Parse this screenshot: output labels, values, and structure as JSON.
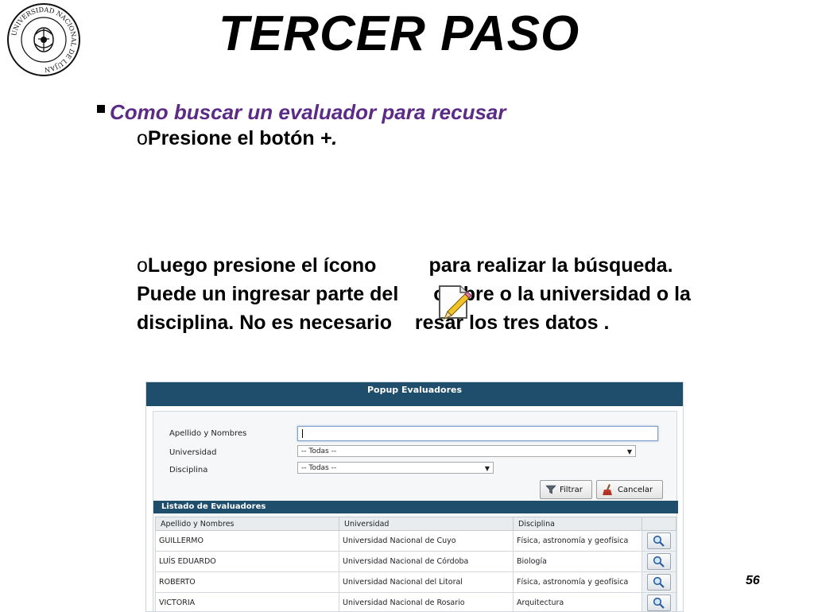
{
  "slide": {
    "title": "TERCER  PASO",
    "bullet_1": "Como buscar un evaluador para recusar",
    "bullet_2_marker": "o",
    "bullet_2_text": "Presione el botón ",
    "bullet_2_plus": "+.",
    "bullet_3_marker": "o",
    "bullet_3_line1_a": "Luego presione el ícono",
    "bullet_3_line1_b": "para realizar la búsqueda.",
    "bullet_3_line2_a": "Puede un ingresar parte del",
    "bullet_3_line2_b": "ombre o la universidad o la",
    "bullet_3_line3_a": "disciplina. No es necesario ",
    "bullet_3_line3_b": "resar los tres datos .",
    "page_number": "56",
    "seal_text": "UNIVERSIDAD NACIONAL DE LUJAN"
  },
  "popup": {
    "title": "Popup Evaluadores",
    "fields": {
      "name_label": "Apellido y Nombres",
      "name_value": "",
      "university_label": "Universidad",
      "university_selected": "-- Todas --",
      "discipline_label": "Disciplina",
      "discipline_selected": "-- Todas --"
    },
    "buttons": {
      "filter": "Filtrar",
      "cancel": "Cancelar"
    },
    "list": {
      "title": "Listado de Evaluadores",
      "columns": [
        "Apellido y Nombres",
        "Universidad",
        "Disciplina"
      ],
      "rows": [
        {
          "name": "GUILLERMO",
          "university": "Universidad Nacional de Cuyo",
          "discipline": "Física, astronomía y geofísica"
        },
        {
          "name": "LUÍS EDUARDO",
          "university": "Universidad Nacional de Córdoba",
          "discipline": "Biología"
        },
        {
          "name": "ROBERTO",
          "university": "Universidad Nacional del Litoral",
          "discipline": "Física, astronomía y geofísica"
        },
        {
          "name": "VICTORIA",
          "university": "Universidad Nacional de Rosario",
          "discipline": "Arquitectura"
        }
      ]
    }
  },
  "colors": {
    "header_blue": "#1f4e6c",
    "bullet_purple": "#5b2b86",
    "input_focus": "#7da2ce"
  },
  "icons": {
    "pencil": "edit-pencil-icon",
    "filter": "funnel-icon",
    "cancel": "broom-icon",
    "search": "magnifier-icon"
  }
}
